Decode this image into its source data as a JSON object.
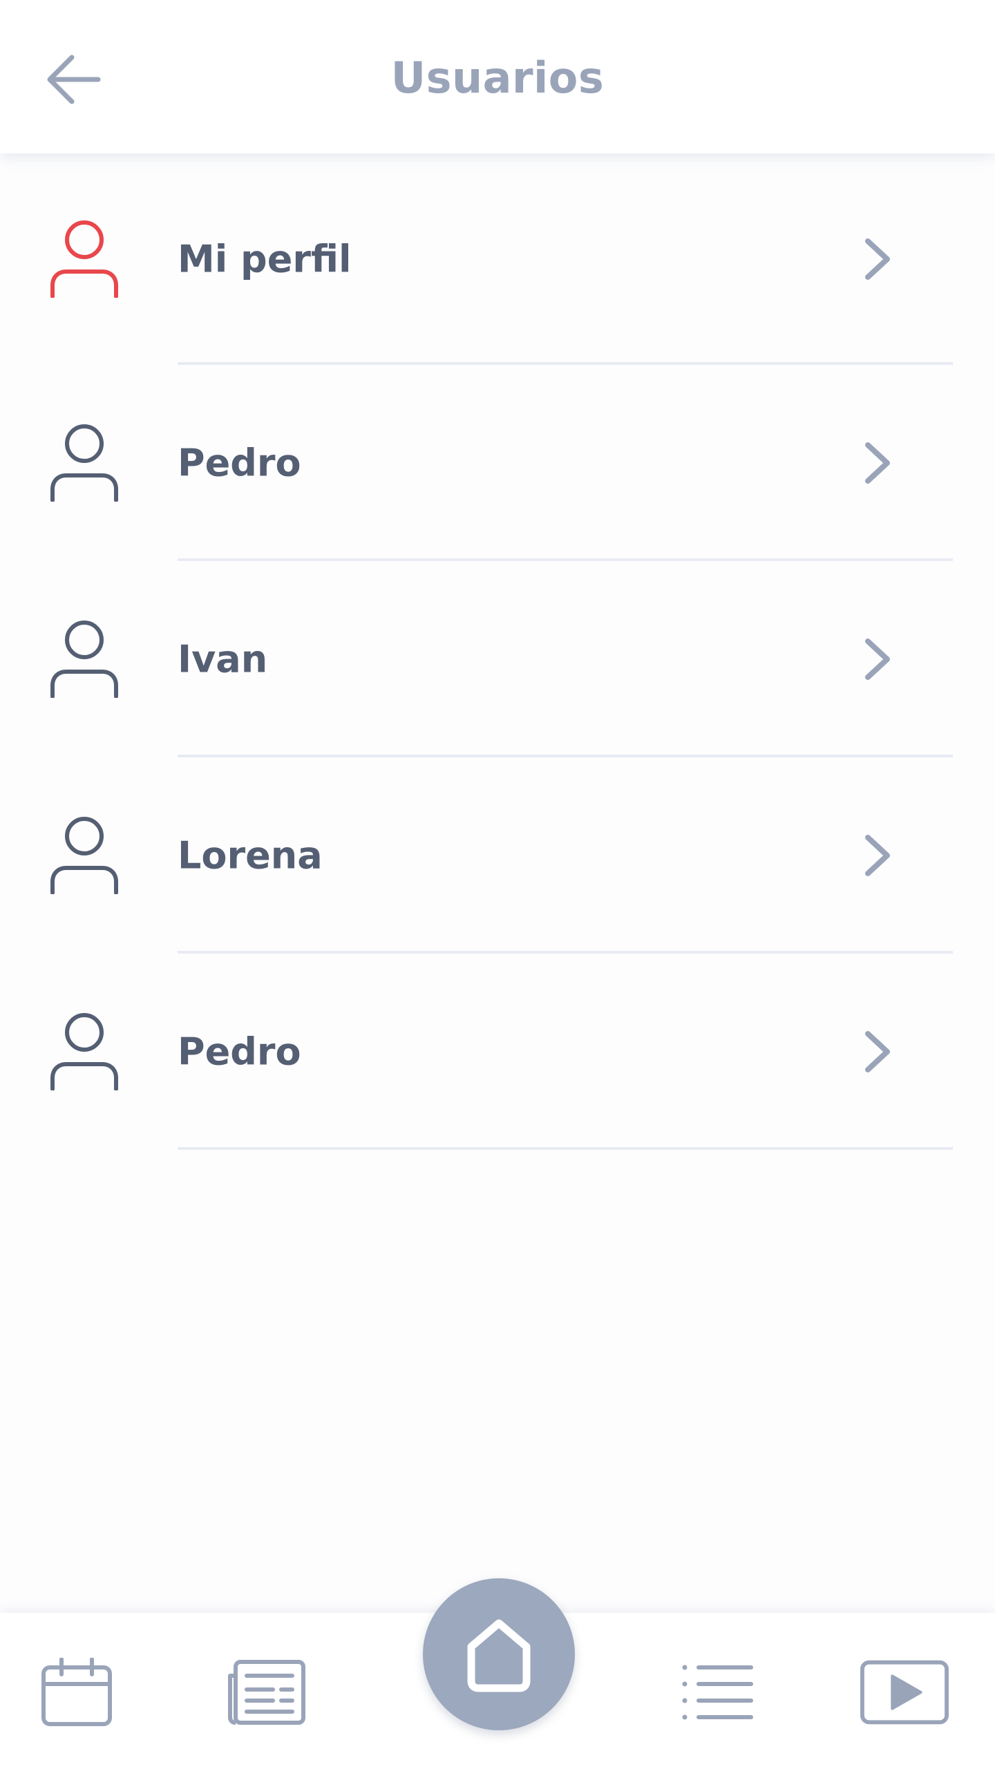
{
  "header": {
    "title": "Usuarios",
    "back_icon": "arrow-left-icon"
  },
  "colors": {
    "title": "#9aa4b9",
    "text": "#555f73",
    "accent_user": "#e8474b",
    "icon": "#555f73",
    "chevron": "#9aa4b9",
    "divider": "#e8ebf3",
    "home_fab": "#9ba8bd"
  },
  "users": [
    {
      "label": "Mi perfil",
      "icon": "user-icon",
      "highlighted": true
    },
    {
      "label": "Pedro",
      "icon": "user-icon",
      "highlighted": false
    },
    {
      "label": "Ivan",
      "icon": "user-icon",
      "highlighted": false
    },
    {
      "label": "Lorena",
      "icon": "user-icon",
      "highlighted": false
    },
    {
      "label": "Pedro",
      "icon": "user-icon",
      "highlighted": false
    }
  ],
  "bottom_nav": {
    "items": [
      {
        "icon": "calendar-icon"
      },
      {
        "icon": "newspaper-icon"
      },
      {
        "icon": "home-icon"
      },
      {
        "icon": "list-icon"
      },
      {
        "icon": "video-play-icon"
      }
    ]
  }
}
